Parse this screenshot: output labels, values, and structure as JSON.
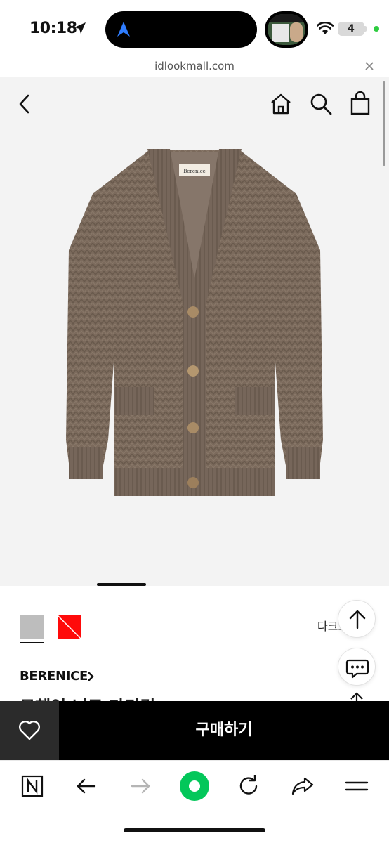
{
  "status": {
    "time": "10:18",
    "battery": "4",
    "accent_green": "#2ecc40"
  },
  "browser": {
    "url": "idlookmall.com",
    "close_icon": "close-icon"
  },
  "header_icons": [
    "back-icon",
    "home-icon",
    "search-icon",
    "shopping-bag-icon"
  ],
  "product": {
    "image_label": "Berenice",
    "colors": [
      {
        "name": "gray",
        "hex": "#bdbdbd",
        "selected": true
      },
      {
        "name": "red",
        "hex": "#ff0a0a",
        "selected": false
      }
    ],
    "selected_color_name": "다크그레이",
    "brand": "BERENICE",
    "name": "모헤어 니트 가디건",
    "garment_color": "#7b6a5c"
  },
  "floating": {
    "top_icon": "arrow-up-icon",
    "chat_icon": "chat-icon"
  },
  "buy_bar": {
    "buy_label": "구매하기",
    "wish_icon": "heart-icon"
  },
  "toolbar": {
    "items": [
      "naver-n-icon",
      "back-arrow-icon",
      "forward-arrow-icon",
      "green-circle-icon",
      "refresh-icon",
      "share-icon",
      "menu-icon"
    ],
    "green": "#03c75a"
  }
}
